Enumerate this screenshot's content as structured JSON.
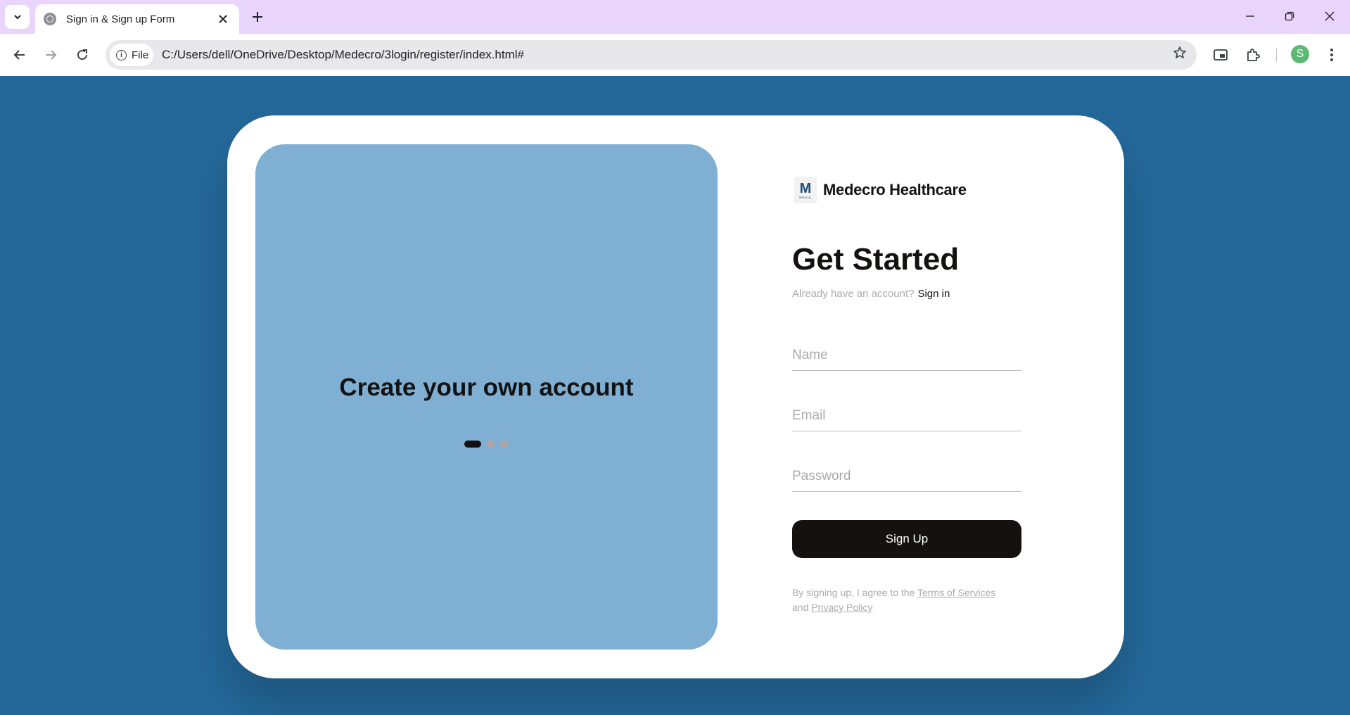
{
  "browser": {
    "tab_title": "Sign in & Sign up Form",
    "url_chip": "File",
    "url": "C:/Users/dell/OneDrive/Desktop/Medecro/3login/register/index.html#",
    "profile_initial": "S"
  },
  "panel": {
    "text": "Create your own account",
    "slides_total": 3,
    "active_slide": 1
  },
  "brand": {
    "logo_letter": "M",
    "logo_subtext": "MEDICAL",
    "name": "Medecro Healthcare"
  },
  "form": {
    "heading": "Get Started",
    "already_text": "Already have an account?",
    "signin_link": "Sign in",
    "name_placeholder": "Name",
    "email_placeholder": "Email",
    "password_placeholder": "Password",
    "submit_label": "Sign Up",
    "terms_prefix": "By signing up, I agree to the",
    "terms_link": "Terms of Services",
    "terms_and": "and",
    "privacy_link": "Privacy Policy"
  },
  "colors": {
    "page_background": "#24689a",
    "panel_background": "#7fb0d4",
    "primary_dark": "#151111"
  }
}
